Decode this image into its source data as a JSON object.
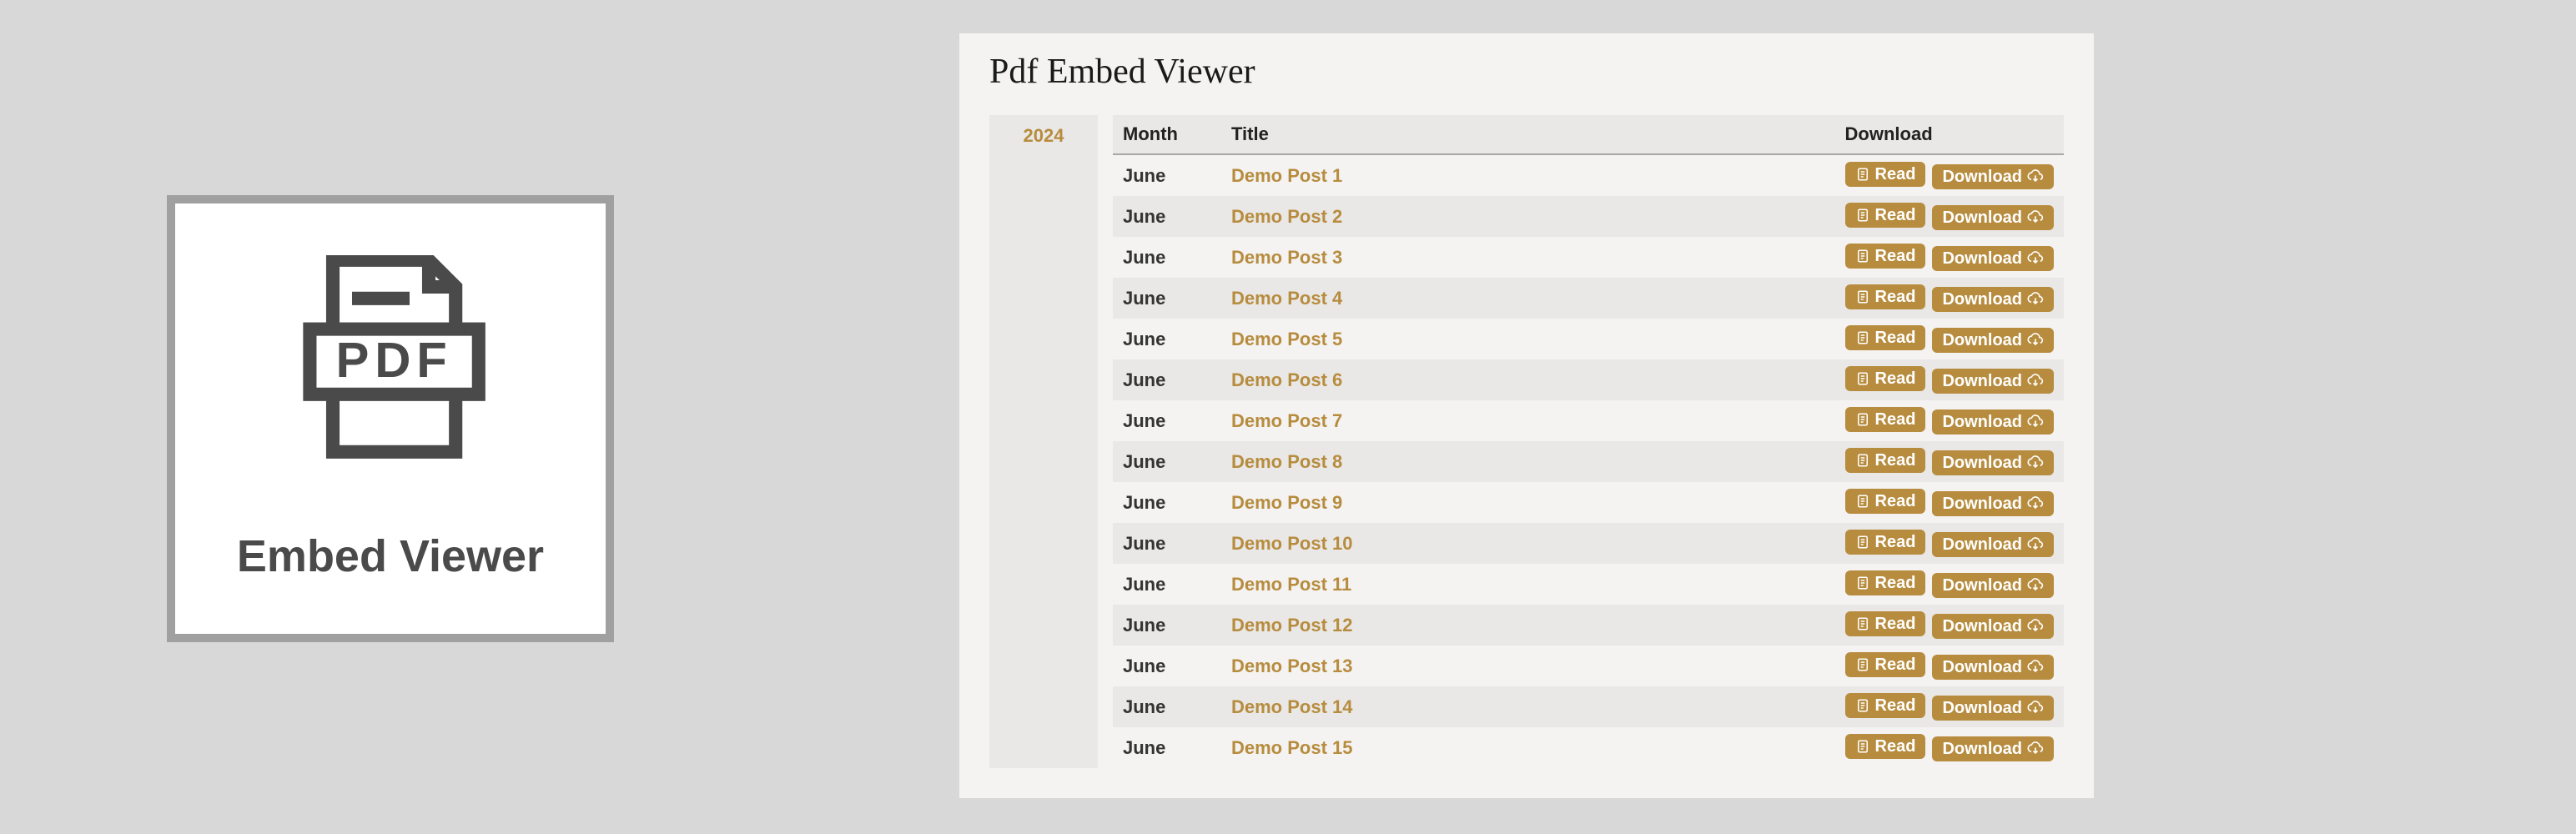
{
  "leftCard": {
    "caption": "Embed Viewer"
  },
  "panel": {
    "title": "Pdf Embed Viewer",
    "year": "2024",
    "columns": {
      "month": "Month",
      "title": "Title",
      "download": "Download"
    },
    "readLabel": "Read",
    "downloadLabel": "Download",
    "rows": [
      {
        "month": "June",
        "title": "Demo Post 1"
      },
      {
        "month": "June",
        "title": "Demo Post 2"
      },
      {
        "month": "June",
        "title": "Demo Post 3"
      },
      {
        "month": "June",
        "title": "Demo Post 4"
      },
      {
        "month": "June",
        "title": "Demo Post 5"
      },
      {
        "month": "June",
        "title": "Demo Post 6"
      },
      {
        "month": "June",
        "title": "Demo Post 7"
      },
      {
        "month": "June",
        "title": "Demo Post 8"
      },
      {
        "month": "June",
        "title": "Demo Post 9"
      },
      {
        "month": "June",
        "title": "Demo Post 10"
      },
      {
        "month": "June",
        "title": "Demo Post 11"
      },
      {
        "month": "June",
        "title": "Demo Post 12"
      },
      {
        "month": "June",
        "title": "Demo Post 13"
      },
      {
        "month": "June",
        "title": "Demo Post 14"
      },
      {
        "month": "June",
        "title": "Demo Post 15"
      }
    ]
  }
}
